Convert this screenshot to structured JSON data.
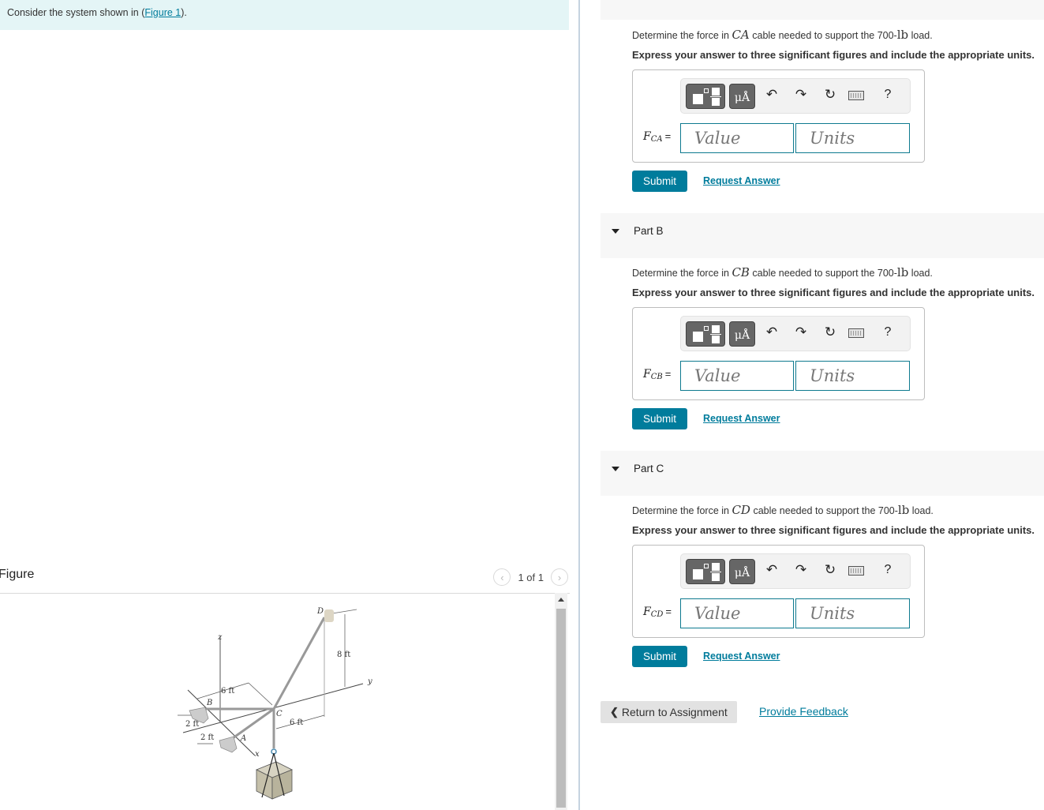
{
  "intro": {
    "text_before": "Consider the system shown in (",
    "link": "Figure 1",
    "text_after": ")."
  },
  "figure": {
    "title": "Figure",
    "page_indicator": "1 of 1",
    "labels": {
      "z": "z",
      "y": "y",
      "x": "x",
      "A": "A",
      "B": "B",
      "C": "C",
      "D": "D",
      "dim_8ft": "8 ft",
      "dim_6ft_left": "6 ft",
      "dim_6ft_right": "6 ft",
      "dim_2ft_top": "2 ft",
      "dim_2ft_bottom": "2 ft"
    }
  },
  "parts": [
    {
      "id": "A",
      "header": "",
      "question_before": "Determine the force in ",
      "question_math": "CA",
      "question_middle": " cable needed to support the 700-",
      "question_unit": "lb",
      "question_after": " load.",
      "instruction": "Express your answer to three significant figures and include the appropriate units.",
      "var_symbol": "F",
      "var_subscript": "CA",
      "value_placeholder": "Value",
      "units_placeholder": "Units",
      "submit": "Submit",
      "request": "Request Answer"
    },
    {
      "id": "B",
      "header": "Part B",
      "question_before": "Determine the force in ",
      "question_math": "CB",
      "question_middle": " cable needed to support the 700-",
      "question_unit": "lb",
      "question_after": " load.",
      "instruction": "Express your answer to three significant figures and include the appropriate units.",
      "var_symbol": "F",
      "var_subscript": "CB",
      "value_placeholder": "Value",
      "units_placeholder": "Units",
      "submit": "Submit",
      "request": "Request Answer"
    },
    {
      "id": "C",
      "header": "Part C",
      "question_before": "Determine the force in ",
      "question_math": "CD",
      "question_middle": " cable needed to support the 700-",
      "question_unit": "lb",
      "question_after": " load.",
      "instruction": "Express your answer to three significant figures and include the appropriate units.",
      "var_symbol": "F",
      "var_subscript": "CD",
      "value_placeholder": "Value",
      "units_placeholder": "Units",
      "submit": "Submit",
      "request": "Request Answer"
    }
  ],
  "toolbar": {
    "templates_icon": "templates-icon",
    "units_label": "μÅ",
    "undo_glyph": "↶",
    "redo_glyph": "↷",
    "reset_glyph": "↻",
    "keyboard_icon": "keyboard-icon",
    "help_label": "?"
  },
  "footer": {
    "return_chevron": "❮",
    "return_label": "Return to Assignment",
    "feedback_label": "Provide Feedback"
  }
}
